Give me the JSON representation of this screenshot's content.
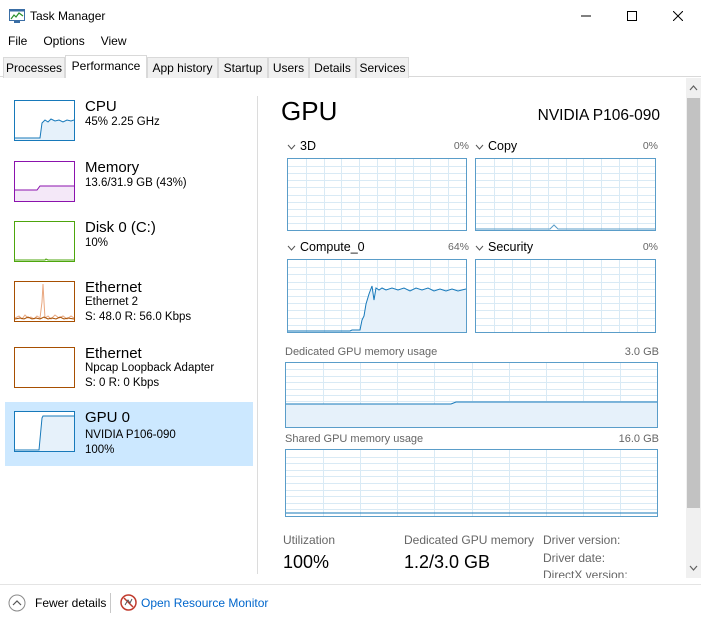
{
  "window": {
    "title": "Task Manager"
  },
  "menu": [
    "File",
    "Options",
    "View"
  ],
  "tabs": [
    "Processes",
    "Performance",
    "App history",
    "Startup",
    "Users",
    "Details",
    "Services"
  ],
  "active_tab": "Performance",
  "sidebar": {
    "items": [
      {
        "title": "CPU",
        "line1": "45%  2.25 GHz",
        "line2": "",
        "color": "#1779ba"
      },
      {
        "title": "Memory",
        "line1": "13.6/31.9 GB (43%)",
        "line2": "",
        "color": "#8b12ae"
      },
      {
        "title": "Disk 0 (C:)",
        "line1": "10%",
        "line2": "",
        "color": "#4da60c"
      },
      {
        "title": "Ethernet",
        "line1": "Ethernet 2",
        "line2": "S: 48.0  R: 56.0 Kbps",
        "color": "#a74f01"
      },
      {
        "title": "Ethernet",
        "line1": "Npcap Loopback Adapter",
        "line2": "S: 0  R: 0 Kbps",
        "color": "#a74f01"
      },
      {
        "title": "GPU 0",
        "line1": "NVIDIA P106-090",
        "line2": "100%",
        "color": "#1779ba"
      }
    ],
    "selected_index": 5
  },
  "main": {
    "title": "GPU",
    "device_name": "NVIDIA P106-090",
    "engines": [
      {
        "name": "3D",
        "percent": "0%"
      },
      {
        "name": "Copy",
        "percent": "0%"
      },
      {
        "name": "Compute_0",
        "percent": "64%"
      },
      {
        "name": "Security",
        "percent": "0%"
      }
    ],
    "dedicated_memory": {
      "label": "Dedicated GPU memory usage",
      "max": "3.0 GB"
    },
    "shared_memory": {
      "label": "Shared GPU memory usage",
      "max": "16.0 GB"
    },
    "stats": [
      {
        "label": "Utilization",
        "value": "100%"
      },
      {
        "label": "Dedicated GPU memory",
        "value": "1.2/3.0 GB"
      }
    ],
    "driver_labels": [
      "Driver version:",
      "Driver date:",
      "DirectX version:"
    ]
  },
  "footer": {
    "fewer_details": "Fewer details",
    "open_resource_monitor": "Open Resource Monitor"
  },
  "colors": {
    "accent_blue": "#1779ba",
    "graph_border": "#5a9dc9",
    "selection": "#cce8ff",
    "link": "#0066cc"
  }
}
